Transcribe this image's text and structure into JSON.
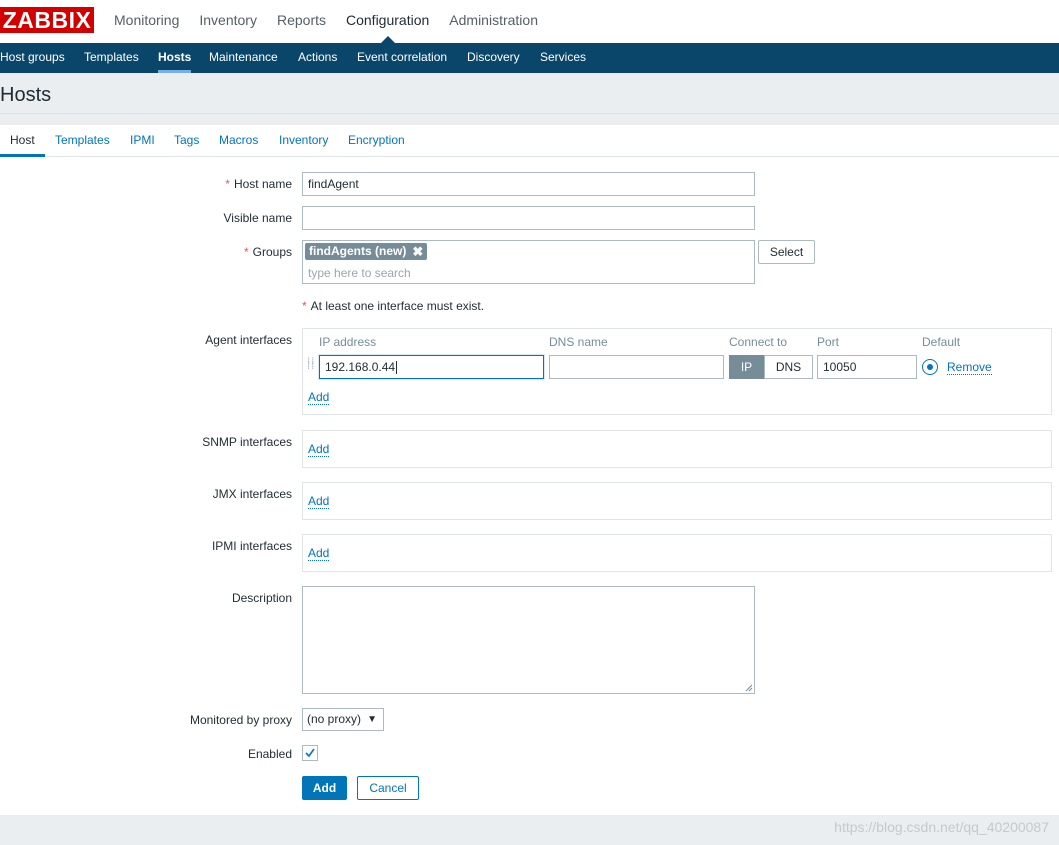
{
  "logo": {
    "text": "ZABBIX"
  },
  "main_menu": {
    "items": [
      "Monitoring",
      "Inventory",
      "Reports",
      "Configuration",
      "Administration"
    ],
    "active": "Configuration"
  },
  "sub_menu": {
    "items": [
      "Host groups",
      "Templates",
      "Hosts",
      "Maintenance",
      "Actions",
      "Event correlation",
      "Discovery",
      "Services"
    ],
    "active": "Hosts"
  },
  "page_title": "Hosts",
  "tabs": {
    "items": [
      "Host",
      "Templates",
      "IPMI",
      "Tags",
      "Macros",
      "Inventory",
      "Encryption"
    ],
    "active": "Host"
  },
  "form": {
    "host_name": {
      "label": "Host name",
      "required_mark": "*",
      "value": "findAgent"
    },
    "visible_name": {
      "label": "Visible name",
      "value": ""
    },
    "groups": {
      "label": "Groups",
      "required_mark": "*",
      "selected": "findAgents (new)",
      "remove_glyph": "✖",
      "placeholder": "type here to search",
      "select_button": "Select"
    },
    "interface_warning": {
      "mark": "*",
      "text": "At least one interface must exist."
    },
    "agent_interfaces": {
      "label": "Agent interfaces",
      "columns": {
        "ip": "IP address",
        "dns": "DNS name",
        "connect": "Connect to",
        "port": "Port",
        "default": "Default"
      },
      "row": {
        "ip": "192.168.0.44",
        "dns": "",
        "connect_ip": "IP",
        "connect_dns": "DNS",
        "connect_selected": "IP",
        "port": "10050",
        "remove": "Remove"
      },
      "add": "Add"
    },
    "snmp_interfaces": {
      "label": "SNMP interfaces",
      "add": "Add"
    },
    "jmx_interfaces": {
      "label": "JMX interfaces",
      "add": "Add"
    },
    "ipmi_interfaces": {
      "label": "IPMI interfaces",
      "add": "Add"
    },
    "description": {
      "label": "Description",
      "value": ""
    },
    "monitored_by_proxy": {
      "label": "Monitored by proxy",
      "value": "(no proxy)",
      "arrow": "▼"
    },
    "enabled": {
      "label": "Enabled",
      "checked": true
    },
    "buttons": {
      "add": "Add",
      "cancel": "Cancel"
    }
  },
  "watermark": "https://blog.csdn.net/qq_40200087",
  "colors": {
    "brand_red": "#d40000",
    "nav_blue": "#0a466a",
    "link_blue": "#0275b8",
    "chip_grey": "#768d99"
  }
}
